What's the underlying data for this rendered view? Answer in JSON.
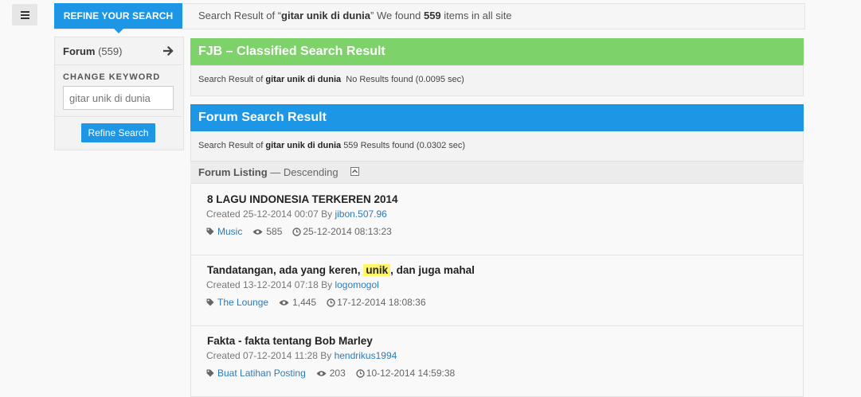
{
  "topbar": {
    "refine_tab_label": "REFINE YOUR SEARCH",
    "summary_prefix": "Search Result of “",
    "query": "gitar unik di dunia",
    "summary_mid": "” We found ",
    "total_count": "559",
    "summary_suffix": " items in all site"
  },
  "sidebar": {
    "forum_label": "Forum",
    "forum_count": "(559)",
    "change_keyword_label": "CHANGE KEYWORD",
    "keyword_placeholder": "gitar unik di dunia",
    "refine_button": "Refine Search"
  },
  "fjb": {
    "title": "FJB – Classified Search Result",
    "result_prefix": "Search Result of",
    "query": "gitar unik di dunia",
    "result_suffix": "No Results found (0.0095 sec)"
  },
  "forum": {
    "title": "Forum Search Result",
    "result_prefix": "Search Result of",
    "query": "gitar unik di dunia",
    "result_suffix": "559 Results found (0.0302 sec)",
    "listing_label": "Forum Listing",
    "listing_sort": "— Descending"
  },
  "items": [
    {
      "title": "8 LAGU INDONESIA TERKEREN 2014",
      "created": "Created 25-12-2014 00:07 By",
      "user": "jibon.507.96",
      "category": "Music",
      "views": "585",
      "last_post": "25-12-2014 08:13:23"
    },
    {
      "title_before": "Tandatangan, ada yang keren,",
      "title_highlight": "unik",
      "title_after": ", dan juga mahal",
      "created": "Created 13-12-2014 07:18 By",
      "user": "logomogol",
      "category": "The Lounge",
      "views": "1,445",
      "last_post": "17-12-2014 18:08:36"
    },
    {
      "title": "Fakta - fakta tentang Bob Marley",
      "created": "Created 07-12-2014 11:28 By",
      "user": "hendrikus1994",
      "category": "Buat Latihan Posting",
      "views": "203",
      "last_post": "10-12-2014 14:59:38"
    }
  ],
  "colors": {
    "accent_blue": "#1e96e6",
    "fjb_green": "#7dd26a",
    "highlight_yellow": "#fff566",
    "link_blue": "#2e7ab8"
  }
}
